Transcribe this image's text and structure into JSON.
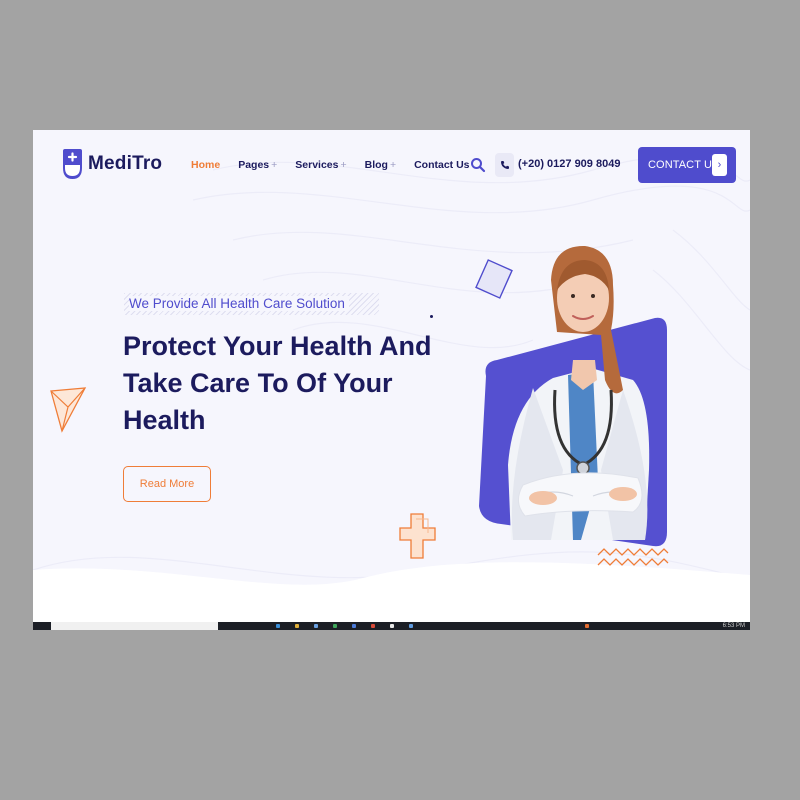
{
  "brand": {
    "name": "MediTro"
  },
  "nav": {
    "items": [
      {
        "label": "Home",
        "has_submenu": false,
        "active": true
      },
      {
        "label": "Pages",
        "has_submenu": true,
        "active": false
      },
      {
        "label": "Services",
        "has_submenu": true,
        "active": false
      },
      {
        "label": "Blog",
        "has_submenu": true,
        "active": false
      },
      {
        "label": "Contact Us",
        "has_submenu": false,
        "active": false
      }
    ],
    "submenu_marker": "+"
  },
  "header": {
    "phone": "(+20) 0127 909 8049",
    "cta_label": "CONTACT US",
    "cta_arrow": "›",
    "search_icon": "search-icon",
    "phone_icon": "phone-icon"
  },
  "hero": {
    "tagline": "We Provide All Health Care Solution",
    "headline": [
      "Protect Your Health And",
      "Take Care To Of Your",
      "Health"
    ],
    "button_label": "Read More",
    "image": "doctor-portrait"
  },
  "taskbar": {
    "clock": "6:53 PM"
  },
  "colors": {
    "primary": "#4f4ccd",
    "accent": "#ef7d38",
    "heading": "#1c1b5e",
    "hero_bg": "#f6f6fd",
    "outer_bg": "#a3a3a3"
  }
}
